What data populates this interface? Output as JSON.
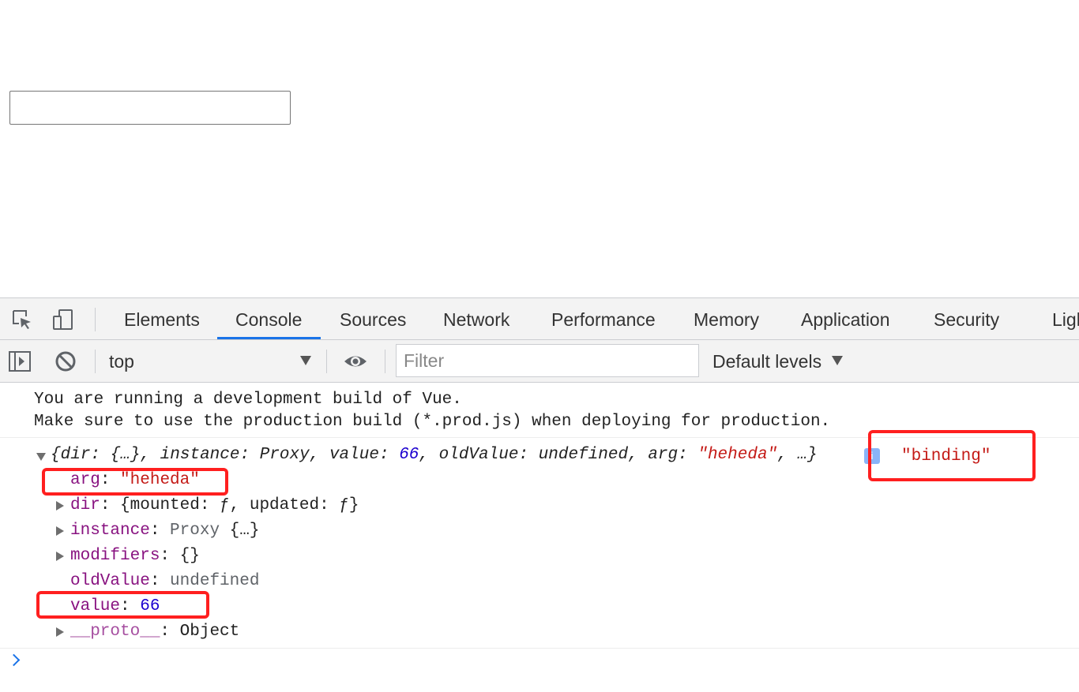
{
  "page": {
    "input_value": ""
  },
  "devtools": {
    "tabs": [
      "Elements",
      "Console",
      "Sources",
      "Network",
      "Performance",
      "Memory",
      "Application",
      "Security",
      "Ligh"
    ],
    "active_tab": "Console",
    "toolbar": {
      "context": "top",
      "filter_placeholder": "Filter",
      "levels": "Default levels"
    },
    "console": {
      "warning_line1": "You are running a development build of Vue.",
      "warning_line2": "Make sure to use the production build (*.prod.js) when deploying for production.",
      "object_summary": {
        "open": "{",
        "dir_key": "dir",
        "dir_val": "{…}",
        "instance_key": "instance",
        "instance_val": "Proxy",
        "value_key": "value",
        "value_val": "66",
        "oldValue_key": "oldValue",
        "oldValue_val": "undefined",
        "arg_key": "arg",
        "arg_val": "\"heheda\"",
        "rest": "…}"
      },
      "log_label": "\"binding\"",
      "properties": {
        "arg": {
          "key": "arg",
          "value": "\"heheda\""
        },
        "dir": {
          "key": "dir",
          "value": "{mounted: ƒ, updated: ƒ}"
        },
        "instance": {
          "key": "instance",
          "type": "Proxy",
          "value": "{…}"
        },
        "modifiers": {
          "key": "modifiers",
          "value": "{}"
        },
        "oldValue": {
          "key": "oldValue",
          "value": "undefined"
        },
        "value": {
          "key": "value",
          "value": "66"
        },
        "proto": {
          "key": "__proto__",
          "value": "Object"
        }
      }
    }
  },
  "colors": {
    "annotation": "#ff1f1f",
    "accent": "#1a73e8",
    "key": "#881280",
    "string": "#c41a16",
    "number": "#1c00cf"
  },
  "icons": [
    "inspect-element-icon",
    "device-toolbar-icon",
    "show-sidebar-icon",
    "clear-console-icon",
    "eye-icon",
    "info-icon",
    "prompt-chevron-icon"
  ]
}
